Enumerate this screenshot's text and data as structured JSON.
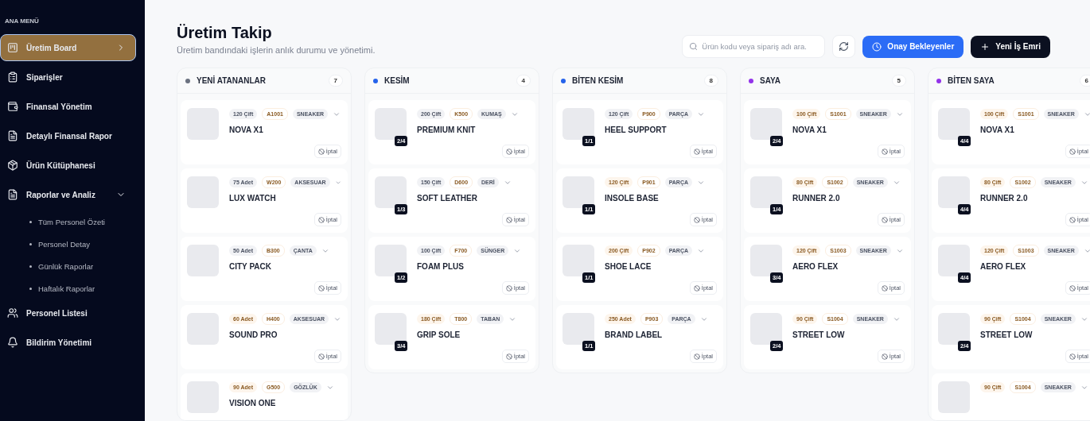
{
  "sidebar": {
    "heading": "ANA MENÜ",
    "items": [
      {
        "label": "Üretim Board",
        "selected": true
      },
      {
        "label": "Siparişler",
        "selected": false
      },
      {
        "label": "Finansal Yönetim",
        "selected": false
      },
      {
        "label": "Detaylı Finansal Rapor",
        "selected": false
      },
      {
        "label": "Ürün Kütüphanesi",
        "selected": false
      },
      {
        "label": "Raporlar ve Analiz",
        "selected": false,
        "expanded": true,
        "children": [
          {
            "label": "Tüm Personel Özeti"
          },
          {
            "label": "Personel Detay"
          },
          {
            "label": "Günlük Raporlar"
          },
          {
            "label": "Haftalık Raporlar"
          }
        ]
      },
      {
        "label": "Personel Listesi",
        "selected": false
      },
      {
        "label": "Bildirim Yönetimi",
        "selected": false
      }
    ]
  },
  "header": {
    "title": "Üretim Takip",
    "subtitle": "Üretim bandındaki işlerin anlık durumu ve yönetimi.",
    "search": {
      "placeholder": "Ürün kodu veya sipariş adı ara."
    },
    "buttons": [
      {
        "kind": "primary",
        "label": "Onay Bekleyenler"
      },
      {
        "kind": "dark",
        "label": "Yeni İş Emri"
      }
    ]
  },
  "columns": [
    {
      "title": "YENİ ATANANLAR",
      "count": "7",
      "color": "#6b7280",
      "cards": [
        {
          "qty": "120 Çift",
          "warm": false,
          "code": "A1001",
          "category": "SNEAKER",
          "name": "NOVA X1",
          "cancel": "İptal"
        },
        {
          "qty": "75 Adet",
          "warm": false,
          "code": "W200",
          "category": "AKSESUAR",
          "name": "LUX WATCH",
          "cancel": "İptal"
        },
        {
          "qty": "50 Adet",
          "warm": false,
          "code": "B300",
          "category": "ÇANTA",
          "name": "CITY PACK",
          "cancel": "İptal"
        },
        {
          "qty": "60 Adet",
          "warm": true,
          "code": "H400",
          "category": "AKSESUAR",
          "name": "SOUND PRO",
          "cancel": "İptal"
        },
        {
          "qty": "90 Adet",
          "warm": true,
          "code": "G500",
          "category": "GÖZLÜK",
          "name": "VISION ONE"
        }
      ]
    },
    {
      "title": "KESİM",
      "count": "4",
      "color": "#2563eb",
      "cards": [
        {
          "qty": "200 Çift",
          "warm": false,
          "code": "K500",
          "category": "KUMAŞ",
          "name": "PREMIUM KNIT",
          "progress": "2/4",
          "cancel": "İptal"
        },
        {
          "qty": "150 Çift",
          "warm": false,
          "code": "D600",
          "category": "DERİ",
          "name": "SOFT LEATHER",
          "progress": "1/3",
          "cancel": "İptal"
        },
        {
          "qty": "100 Çift",
          "warm": false,
          "code": "F700",
          "category": "SÜNGER",
          "name": "FOAM PLUS",
          "progress": "1/2",
          "cancel": "İptal"
        },
        {
          "qty": "180 Çift",
          "warm": true,
          "code": "T800",
          "category": "TABAN",
          "name": "GRIP SOLE",
          "progress": "3/4",
          "cancel": "İptal"
        }
      ]
    },
    {
      "title": "BİTEN KESİM",
      "count": "8",
      "color": "#2563eb",
      "cards": [
        {
          "qty": "120 Çift",
          "warm": false,
          "code": "P900",
          "category": "PARÇA",
          "name": "HEEL SUPPORT",
          "progress": "1/1",
          "cancel": "İptal"
        },
        {
          "qty": "120 Çift",
          "warm": true,
          "code": "P901",
          "category": "PARÇA",
          "name": "INSOLE BASE",
          "progress": "1/1",
          "cancel": "İptal"
        },
        {
          "qty": "200 Çift",
          "warm": true,
          "code": "P902",
          "category": "PARÇA",
          "name": "SHOE LACE",
          "progress": "1/1",
          "cancel": "İptal"
        },
        {
          "qty": "250 Adet",
          "warm": true,
          "code": "P903",
          "category": "PARÇA",
          "name": "BRAND LABEL",
          "progress": "1/1",
          "cancel": "İptal"
        }
      ]
    },
    {
      "title": "SAYA",
      "count": "5",
      "color": "#9333ea",
      "cards": [
        {
          "qty": "100 Çift",
          "warm": true,
          "code": "S1001",
          "category": "SNEAKER",
          "name": "NOVA X1",
          "progress": "2/4",
          "cancel": "İptal"
        },
        {
          "qty": "80 Çift",
          "warm": true,
          "code": "S1002",
          "category": "SNEAKER",
          "name": "RUNNER 2.0",
          "progress": "1/4",
          "cancel": "İptal"
        },
        {
          "qty": "120 Çift",
          "warm": true,
          "code": "S1003",
          "category": "SNEAKER",
          "name": "AERO FLEX",
          "progress": "3/4",
          "cancel": "İptal"
        },
        {
          "qty": "90 Çift",
          "warm": true,
          "code": "S1004",
          "category": "SNEAKER",
          "name": "STREET LOW",
          "progress": "2/4",
          "cancel": "İptal"
        }
      ]
    },
    {
      "title": "BİTEN SAYA",
      "count": "6",
      "color": "#9333ea",
      "cards": [
        {
          "qty": "100 Çift",
          "warm": true,
          "code": "S1001",
          "category": "SNEAKER",
          "name": "NOVA X1",
          "progress": "4/4",
          "cancel": "İptal"
        },
        {
          "qty": "80 Çift",
          "warm": true,
          "code": "S1002",
          "category": "SNEAKER",
          "name": "RUNNER 2.0",
          "progress": "4/4",
          "cancel": "İptal"
        },
        {
          "qty": "120 Çift",
          "warm": true,
          "code": "S1003",
          "category": "SNEAKER",
          "name": "AERO FLEX",
          "progress": "4/4",
          "cancel": "İptal"
        },
        {
          "qty": "90 Çift",
          "warm": true,
          "code": "S1004",
          "category": "SNEAKER",
          "name": "STREET LOW",
          "progress": "2/4",
          "cancel": "İptal"
        },
        {
          "qty": "90 Çift",
          "warm": true,
          "code": "S1004",
          "category": "SNEAKER"
        }
      ]
    }
  ]
}
